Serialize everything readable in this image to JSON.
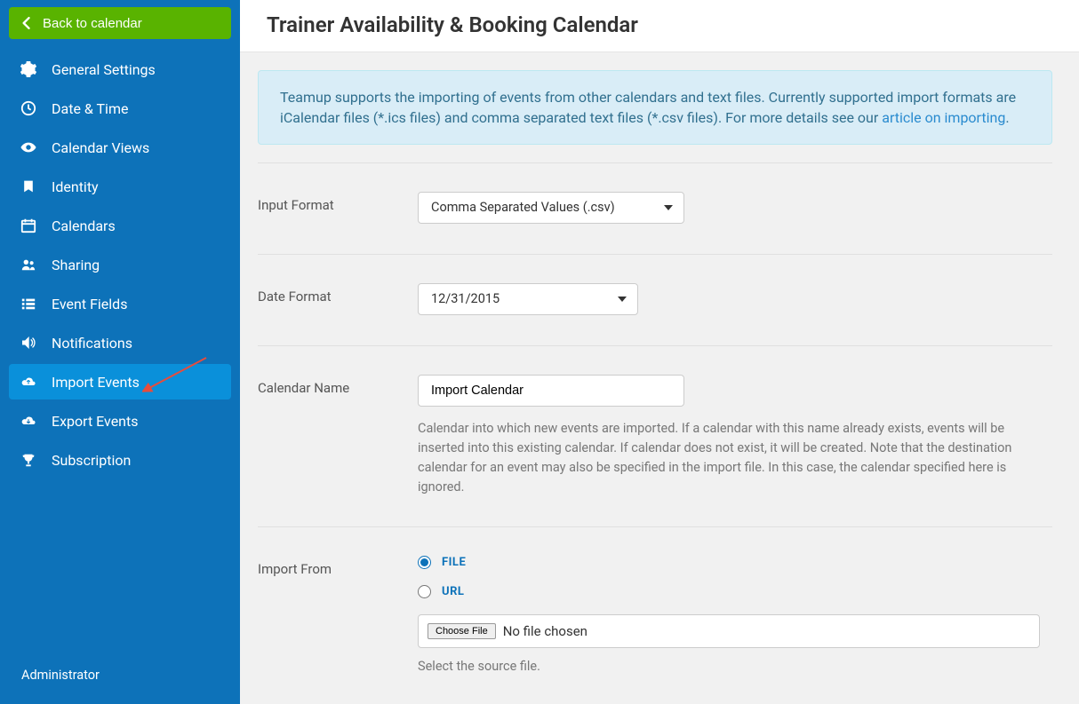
{
  "header": {
    "title": "Trainer Availability & Booking Calendar"
  },
  "back_button": {
    "label": "Back to calendar"
  },
  "sidebar": {
    "items": [
      {
        "label": "General Settings",
        "icon": "gear-icon"
      },
      {
        "label": "Date & Time",
        "icon": "clock-icon"
      },
      {
        "label": "Calendar Views",
        "icon": "eye-icon"
      },
      {
        "label": "Identity",
        "icon": "bookmark-icon"
      },
      {
        "label": "Calendars",
        "icon": "calendar-icon"
      },
      {
        "label": "Sharing",
        "icon": "people-icon"
      },
      {
        "label": "Event Fields",
        "icon": "list-icon"
      },
      {
        "label": "Notifications",
        "icon": "volume-icon"
      },
      {
        "label": "Import Events",
        "icon": "cloud-up-icon",
        "active": true
      },
      {
        "label": "Export Events",
        "icon": "cloud-down-icon"
      },
      {
        "label": "Subscription",
        "icon": "trophy-icon"
      }
    ]
  },
  "footer": {
    "role": "Administrator"
  },
  "info": {
    "text_before": "Teamup supports the importing of events from other calendars and text files. Currently supported import formats are iCalendar files (*.ics files) and comma separated text files (*.csv files). For more details see our ",
    "link_text": "article on importing",
    "text_after": "."
  },
  "form": {
    "input_format": {
      "label": "Input Format",
      "value": "Comma Separated Values (.csv)"
    },
    "date_format": {
      "label": "Date Format",
      "value": "12/31/2015"
    },
    "calendar_name": {
      "label": "Calendar Name",
      "value": "Import Calendar",
      "help": "Calendar into which new events are imported. If a calendar with this name already exists, events will be inserted into this existing calendar. If calendar does not exist, it will be created. Note that the destination calendar for an event may also be specified in the import file. In this case, the calendar specified here is ignored."
    },
    "import_from": {
      "label": "Import From",
      "options": {
        "file": "FILE",
        "url": "URL"
      },
      "selected": "file",
      "choose_file_label": "Choose File",
      "file_status": "No file chosen",
      "help": "Select the source file."
    }
  }
}
